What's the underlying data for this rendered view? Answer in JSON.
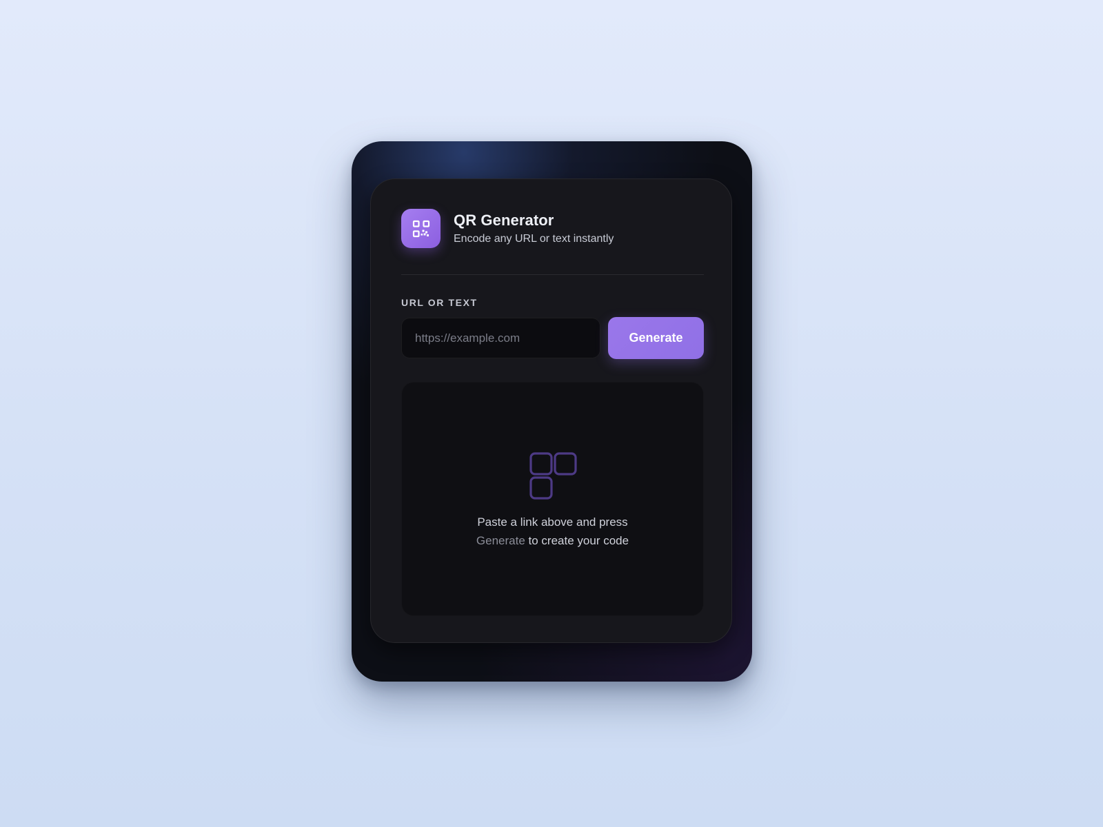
{
  "app": {
    "title": "QR Generator",
    "subtitle": "Encode any URL or text instantly",
    "icon": "qr-code-icon",
    "accent_color": "#9a77ea"
  },
  "form": {
    "label": "URL OR TEXT",
    "input_value": "",
    "input_placeholder": "https://example.com",
    "generate_label": "Generate"
  },
  "preview": {
    "icon": "qr-placeholder-icon",
    "message_line1": "Paste a link above and press",
    "message_highlight": "Generate",
    "message_line2_rest": " to create your code"
  }
}
